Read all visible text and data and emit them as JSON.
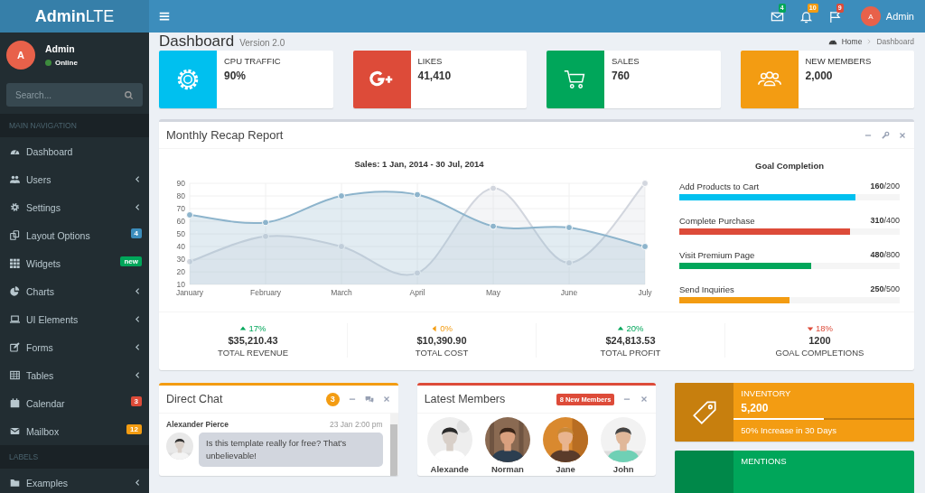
{
  "header": {
    "logo": "**Admin**LTE",
    "notifications": [
      {
        "count": "4",
        "color": "#00a65a"
      },
      {
        "count": "10",
        "color": "#f39c12"
      },
      {
        "count": "9",
        "color": "#dd4b39"
      }
    ],
    "user": {
      "initial": "A",
      "name": "Admin"
    }
  },
  "sidebar": {
    "user": {
      "initial": "A",
      "name": "Admin",
      "status": "Online"
    },
    "search": {
      "placeholder": "Search..."
    },
    "sections": [
      {
        "heading": "MAIN NAVIGATION",
        "items": [
          {
            "label": "Dashboard",
            "kind": "plain"
          },
          {
            "label": "Users",
            "kind": "submenu"
          },
          {
            "label": "Settings",
            "kind": "submenu"
          },
          {
            "label": "Layout Options",
            "kind": "badge",
            "badge": "4",
            "color": "#3c8dbc"
          },
          {
            "label": "Widgets",
            "kind": "badge",
            "badge": "new",
            "color": "#00a65a"
          },
          {
            "label": "Charts",
            "kind": "submenu"
          },
          {
            "label": "UI Elements",
            "kind": "submenu"
          },
          {
            "label": "Forms",
            "kind": "submenu"
          },
          {
            "label": "Tables",
            "kind": "submenu"
          },
          {
            "label": "Calendar",
            "kind": "badge",
            "badge": "3",
            "color": "#dd4b39"
          },
          {
            "label": "Mailbox",
            "kind": "badge",
            "badge": "12",
            "color": "#f39c12"
          }
        ]
      },
      {
        "heading": "LABELS",
        "items": [
          {
            "label": "Examples",
            "kind": "submenu"
          }
        ]
      }
    ]
  },
  "page": {
    "title": "Dashboard",
    "subtitle": "Version 2.0",
    "breadcrumb": [
      "Home",
      "Dashboard"
    ]
  },
  "info_boxes": [
    {
      "label": "CPU TRAFFIC",
      "value": "90%",
      "color": "#00c0ef"
    },
    {
      "label": "LIKES",
      "value": "41,410",
      "color": "#dd4b39"
    },
    {
      "label": "SALES",
      "value": "760",
      "color": "#00a65a"
    },
    {
      "label": "NEW MEMBERS",
      "value": "2,000",
      "color": "#f39c12"
    }
  ],
  "recap": {
    "title": "Monthly Recap Report",
    "chart_data": {
      "type": "area",
      "grid": true,
      "title": "Sales: 1 Jan, 2014 - 30 Jul, 2014",
      "categories": [
        "January",
        "February",
        "March",
        "April",
        "May",
        "June",
        "July"
      ],
      "ylim": [
        10,
        90
      ],
      "yticks": [
        10,
        20,
        30,
        40,
        50,
        60,
        70,
        80,
        90
      ],
      "series": [
        {
          "color": "#d2d6de",
          "values": [
            28,
            48,
            40,
            19,
            86,
            27,
            90
          ]
        },
        {
          "color": "#8db4cc",
          "values": [
            65,
            59,
            80,
            81,
            56,
            55,
            40
          ]
        }
      ]
    },
    "goals": {
      "title": "Goal Completion",
      "items": [
        {
          "label": "Add Products to Cart",
          "value": "**160**/200",
          "level": 0.8,
          "color": "#00c0ef"
        },
        {
          "label": "Complete Purchase",
          "value": "**310**/400",
          "level": 0.775,
          "color": "#dd4b39"
        },
        {
          "label": "Visit Premium Page",
          "value": "**480**/800",
          "level": 0.6,
          "color": "#00a65a"
        },
        {
          "label": "Send Inquiries",
          "value": "**250**/500",
          "level": 0.5,
          "color": "#f39c12"
        }
      ]
    },
    "stats": [
      {
        "kind": "up",
        "change": "17%",
        "value": "$35,210.43",
        "label": "TOTAL REVENUE"
      },
      {
        "kind": "flat",
        "change": "0%",
        "value": "$10,390.90",
        "label": "TOTAL COST"
      },
      {
        "kind": "up",
        "change": "20%",
        "value": "$24,813.53",
        "label": "TOTAL PROFIT"
      },
      {
        "kind": "down",
        "change": "18%",
        "value": "1200",
        "label": "GOAL COMPLETIONS"
      }
    ]
  },
  "chat": {
    "title": "Direct Chat",
    "badge": "3",
    "messages": [
      {
        "name": "Alexander Pierce",
        "time": "23 Jan 2:00 pm",
        "text": "Is this template really for free? That's unbelievable!"
      }
    ]
  },
  "members": {
    "title": "Latest Members",
    "badge": "8 New Members",
    "names": [
      "Alexande",
      "Norman",
      "Jane",
      "John"
    ]
  },
  "progress_boxes": [
    {
      "label": "INVENTORY",
      "value": "5,200",
      "level": 0.5,
      "description": "50% Increase in 30 Days",
      "color": "#f39c12"
    },
    {
      "label": "MENTIONS",
      "color": "#00a65a"
    }
  ]
}
